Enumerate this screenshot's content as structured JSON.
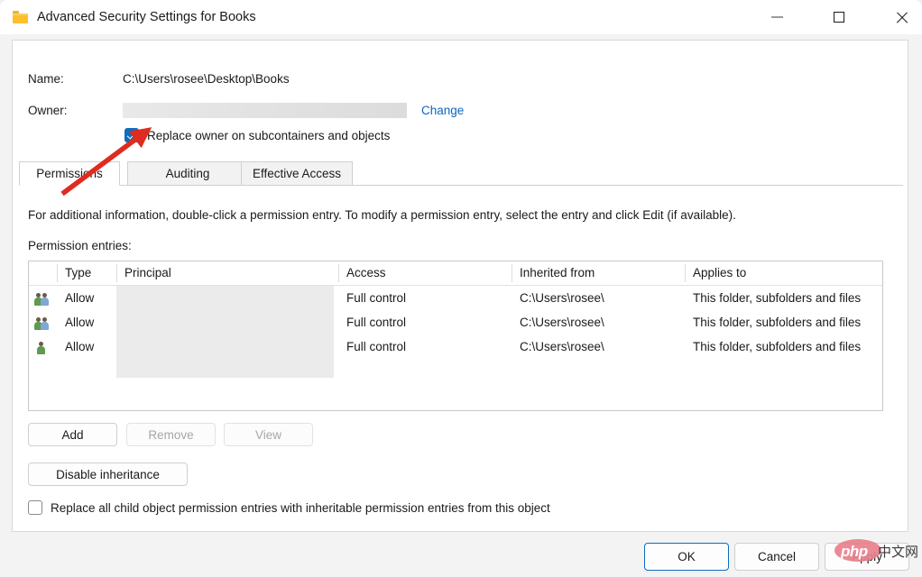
{
  "window": {
    "title": "Advanced Security Settings for Books",
    "icon": "folder-icon",
    "controls": {
      "minimize": "minimize-icon",
      "maximize": "maximize-icon",
      "close": "close-icon"
    }
  },
  "header": {
    "name_label": "Name:",
    "name_value": "C:\\Users\\rosee\\Desktop\\Books",
    "owner_label": "Owner:",
    "owner_value": "",
    "change_link": "Change",
    "replace_owner_label": "Replace owner on subcontainers and objects",
    "replace_owner_checked": true
  },
  "tabs": [
    {
      "label": "Permissions",
      "active": true
    },
    {
      "label": "Auditing",
      "active": false
    },
    {
      "label": "Effective Access",
      "active": false
    }
  ],
  "main": {
    "info_text": "For additional information, double-click a permission entry. To modify a permission entry, select the entry and click Edit (if available).",
    "entries_label": "Permission entries:",
    "columns": [
      "",
      "Type",
      "Principal",
      "Access",
      "Inherited from",
      "Applies to"
    ],
    "rows": [
      {
        "icon": "group-icon",
        "type": "Allow",
        "principal": "",
        "access": "Full control",
        "inherited_from": "C:\\Users\\rosee\\",
        "applies_to": "This folder, subfolders and files"
      },
      {
        "icon": "group-icon",
        "type": "Allow",
        "principal": "",
        "access": "Full control",
        "inherited_from": "C:\\Users\\rosee\\",
        "applies_to": "This folder, subfolders and files"
      },
      {
        "icon": "user-icon",
        "type": "Allow",
        "principal": "",
        "access": "Full control",
        "inherited_from": "C:\\Users\\rosee\\",
        "applies_to": "This folder, subfolders and files"
      }
    ],
    "buttons": {
      "add": "Add",
      "remove": "Remove",
      "view": "View",
      "disable_inheritance": "Disable inheritance"
    },
    "replace_child_label": "Replace all child object permission entries with inheritable permission entries from this object",
    "replace_child_checked": false
  },
  "footer": {
    "ok": "OK",
    "cancel": "Cancel",
    "apply": "Apply"
  },
  "watermark": {
    "php": "php",
    "cn": "中文网"
  },
  "colors": {
    "accent": "#0f6cbd",
    "link": "#0a66c2",
    "annotation": "#e02b20",
    "redaction": "#ebebeb"
  }
}
